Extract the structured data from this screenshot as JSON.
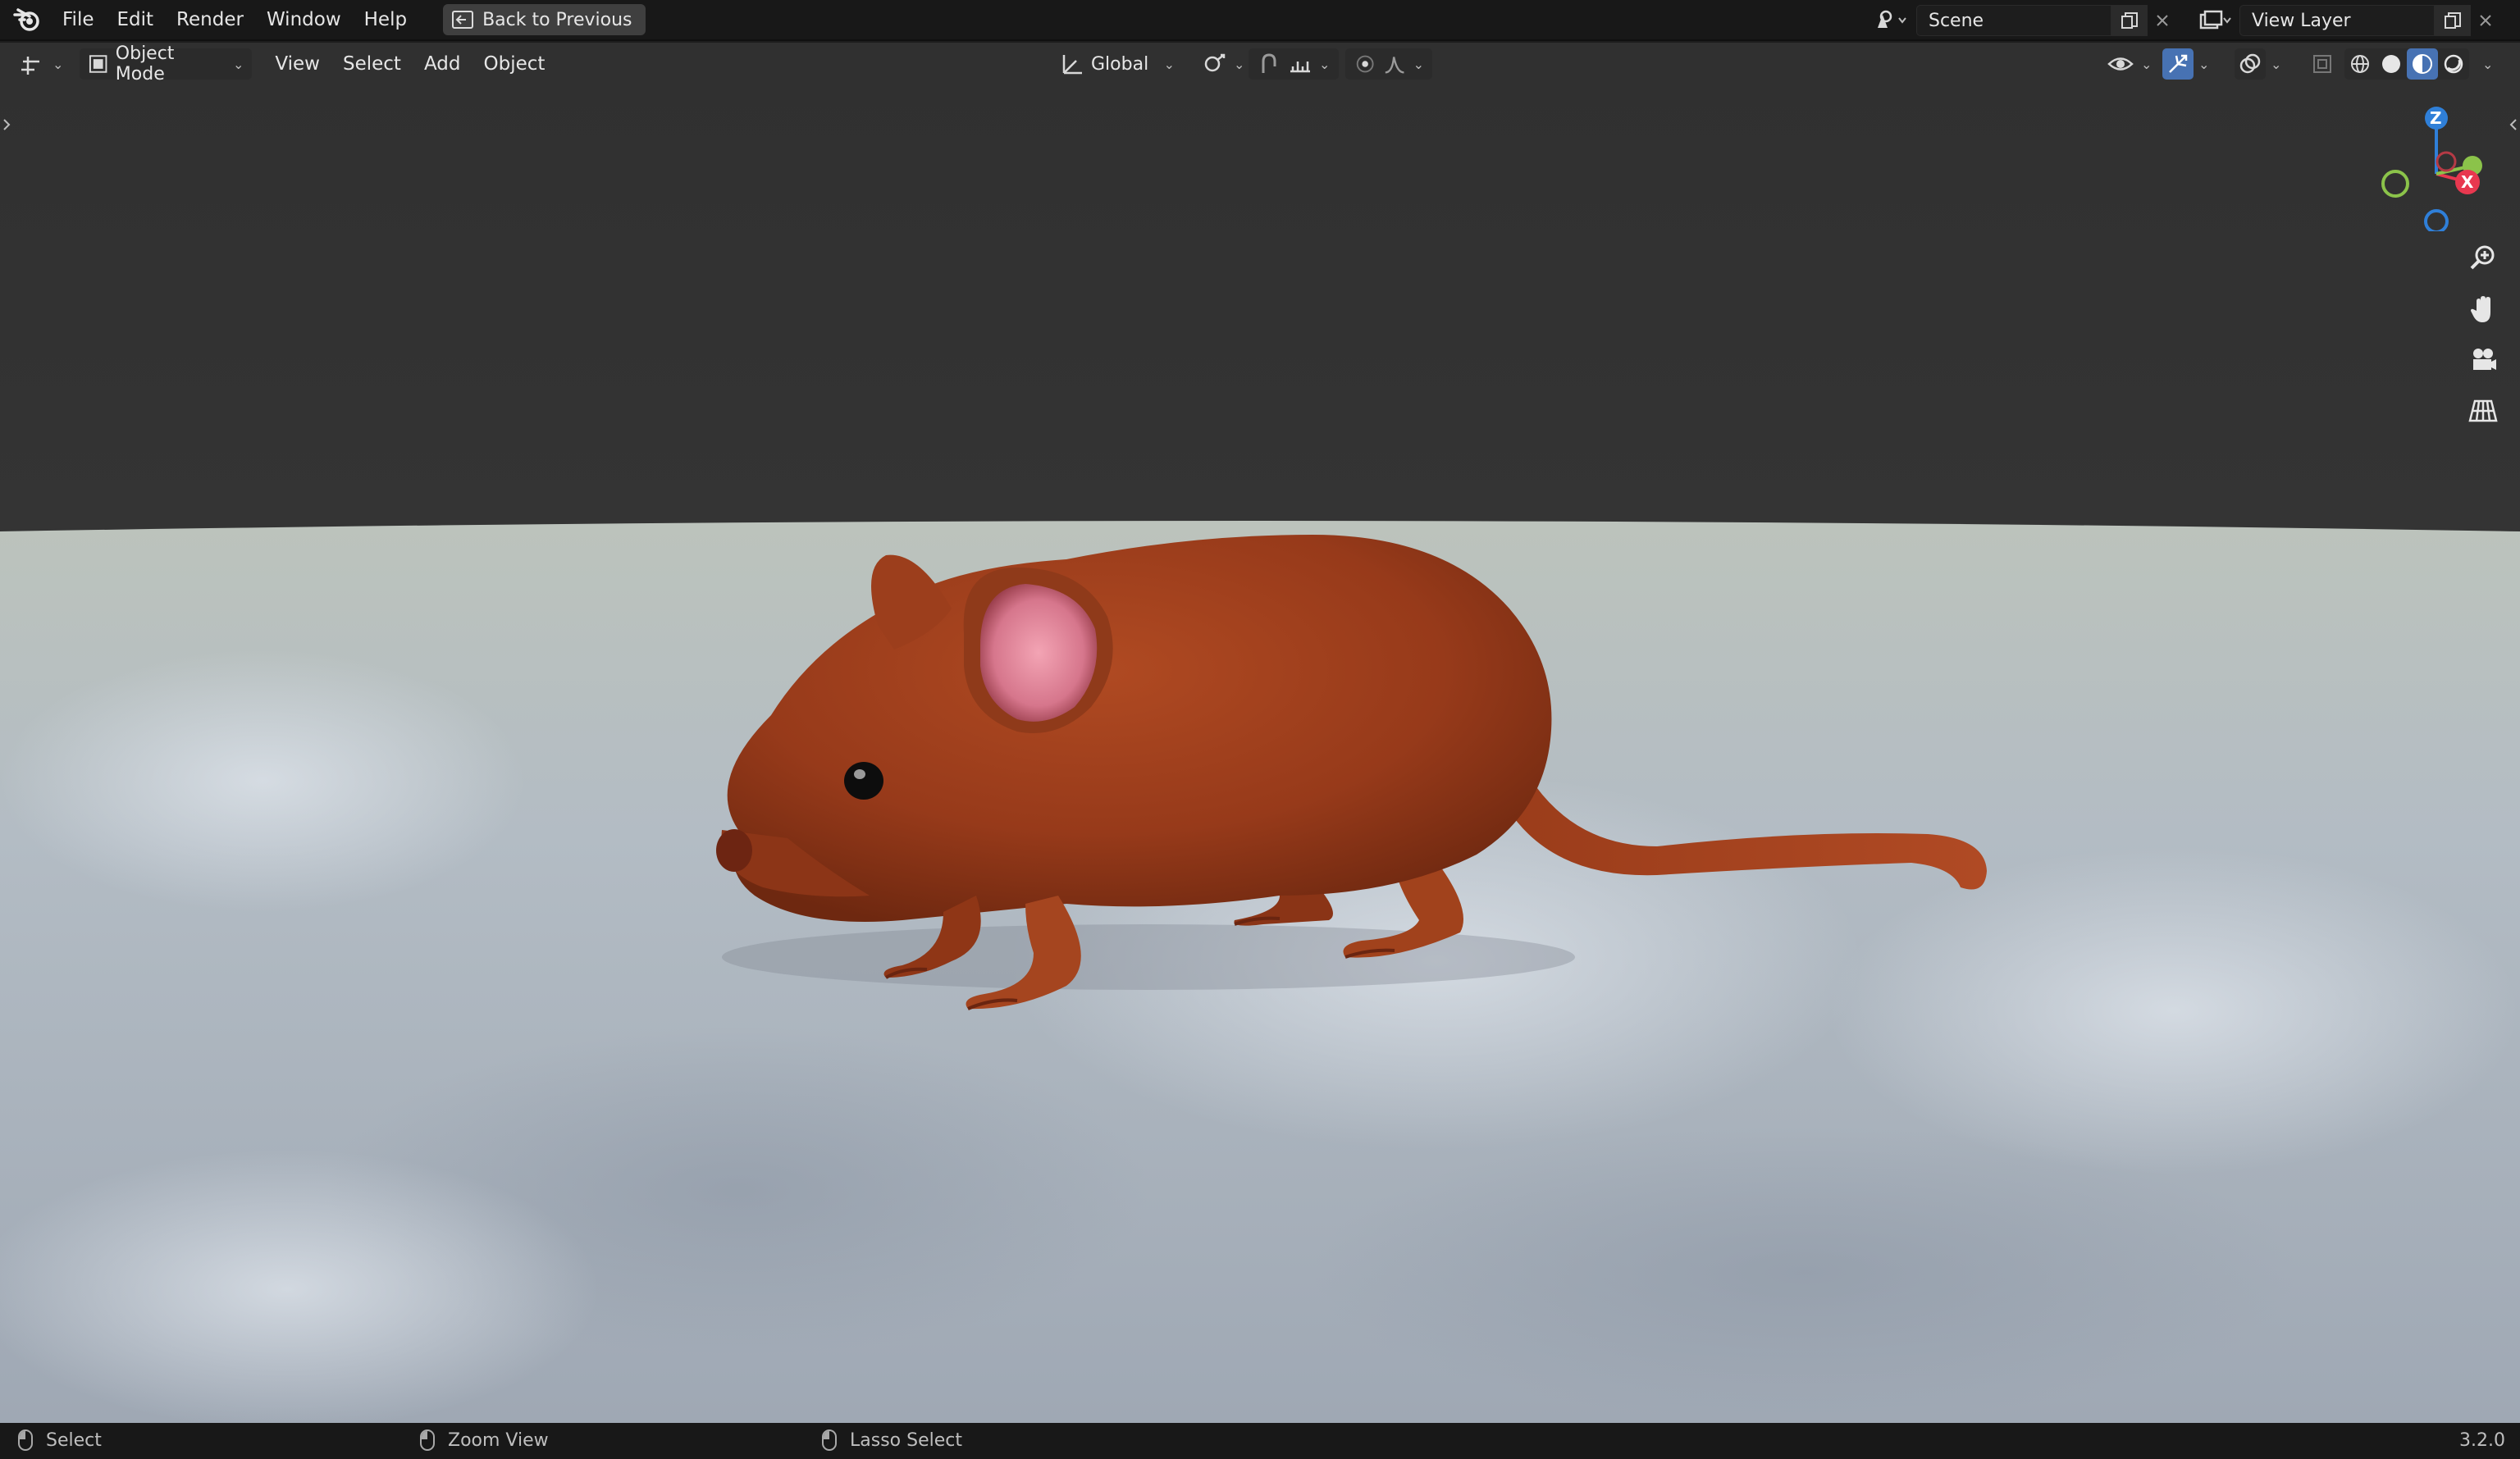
{
  "topbar": {
    "menus": [
      "File",
      "Edit",
      "Render",
      "Window",
      "Help"
    ],
    "back_button": "Back to Previous",
    "scene_name": "Scene",
    "view_layer_name": "View Layer"
  },
  "header": {
    "mode": "Object Mode",
    "menus": [
      "View",
      "Select",
      "Add",
      "Object"
    ],
    "transform_orientation": "Global"
  },
  "gizmo": {
    "axes": [
      "Z",
      "X"
    ]
  },
  "statusbar": {
    "left": "Select",
    "middle": "Zoom View",
    "right": "Lasso Select",
    "version": "3.2.0"
  },
  "colors": {
    "accent": "#4772b3",
    "x_axis": "#e8384f",
    "y_axis": "#8bc34a",
    "z_axis": "#2f7fd8",
    "mouse_fur": "#9c3f1d",
    "ear_inner": "#e07f95"
  },
  "icons": [
    "blender-logo-icon",
    "back-icon",
    "scene-icon",
    "copy-icon",
    "close-icon",
    "view-layer-icon",
    "editor-type-icon",
    "object-mode-icon",
    "orientation-icon",
    "pivot-icon",
    "snap-icon",
    "proportional-icon",
    "visibility-icon",
    "gizmo-icon",
    "overlay-icon",
    "xray-icon",
    "wireframe-shading-icon",
    "solid-shading-icon",
    "material-shading-icon",
    "rendered-shading-icon",
    "zoom-icon",
    "hand-icon",
    "camera-icon",
    "grid-icon",
    "mouse-icon"
  ]
}
